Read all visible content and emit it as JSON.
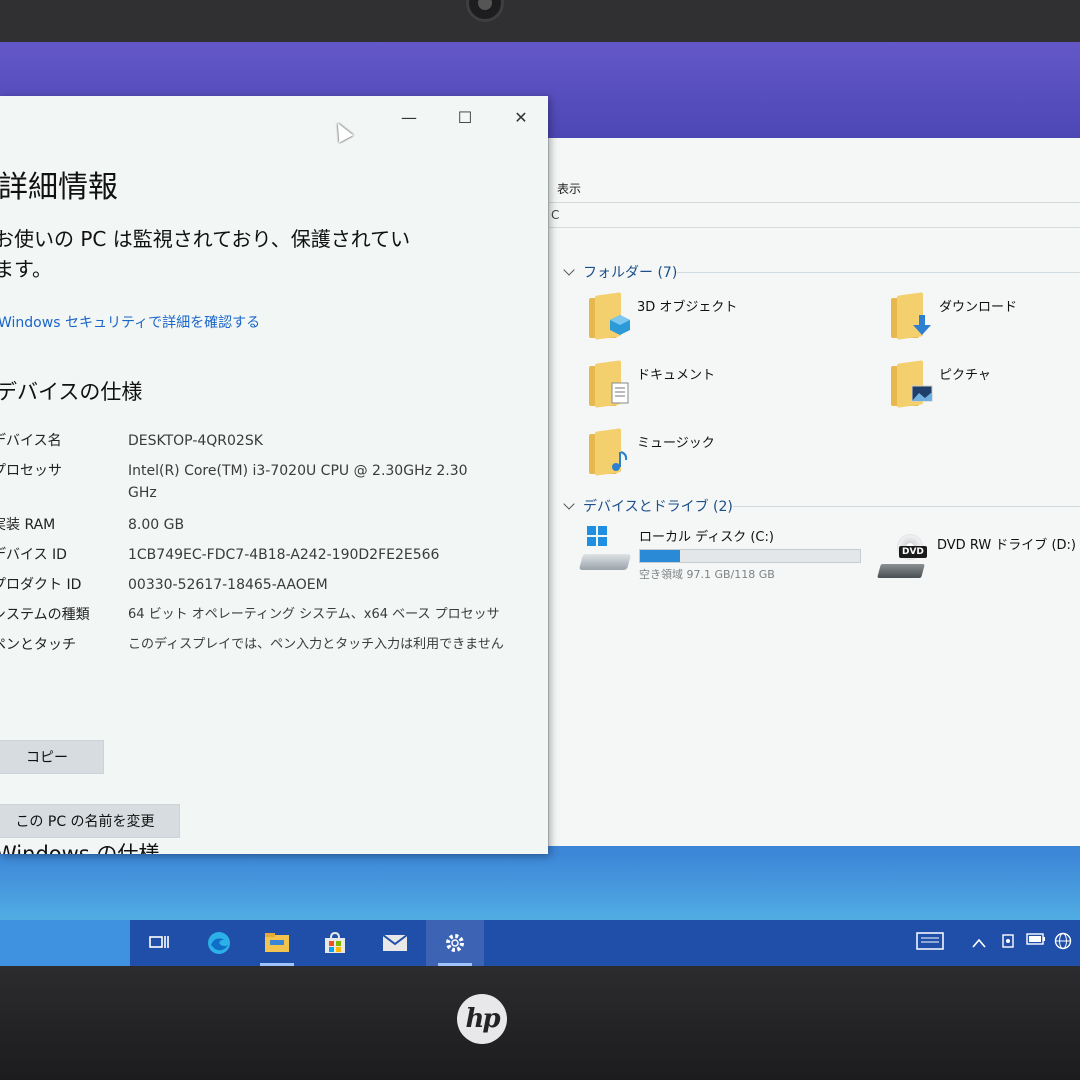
{
  "explorer": {
    "menu_view": "表示",
    "address_fragment": "C",
    "folders_header": "フォルダー (7)",
    "folders": [
      {
        "label": "3D オブジェクト",
        "icon": "3d-objects-icon"
      },
      {
        "label": "ダウンロード",
        "icon": "download-icon"
      },
      {
        "label": "ドキュメント",
        "icon": "document-icon"
      },
      {
        "label": "ピクチャ",
        "icon": "picture-icon"
      },
      {
        "label": "ミュージック",
        "icon": "music-icon"
      }
    ],
    "devices_header": "デバイスとドライブ (2)",
    "local_disk": {
      "name": "ローカル ディスク (C:)",
      "free_text": "空き領域 97.1 GB/118 GB",
      "used_fraction": 0.18
    },
    "dvd_drive": {
      "name": "DVD RW ドライブ (D:)",
      "badge": "DVD"
    }
  },
  "settings": {
    "title": "詳細情報",
    "status": "お使いの PC は監視されており、保護されています。",
    "security_link": "Windows セキュリティで詳細を確認する",
    "device_spec_heading": "デバイスの仕様",
    "specs": [
      {
        "key": "デバイス名",
        "value": "DESKTOP-4QR02SK"
      },
      {
        "key": "プロセッサ",
        "value": "Intel(R) Core(TM) i3-7020U CPU @ 2.30GHz   2.30 GHz"
      },
      {
        "key": "実装 RAM",
        "value": "8.00 GB"
      },
      {
        "key": "デバイス ID",
        "value": "1CB749EC-FDC7-4B18-A242-190D2FE2E566"
      },
      {
        "key": "プロダクト ID",
        "value": "00330-52617-18465-AAOEM"
      },
      {
        "key": "システムの種類",
        "value": "64 ビット オペレーティング システム、x64 ベース プロセッサ"
      },
      {
        "key": "ペンとタッチ",
        "value": "このディスプレイでは、ペン入力とタッチ入力は利用できません"
      }
    ],
    "copy_button": "コピー",
    "rename_button": "この PC の名前を変更",
    "windows_spec_heading": "Windows の仕様"
  },
  "window_controls": {
    "minimize": "—",
    "maximize": "☐",
    "close": "✕"
  },
  "brand": {
    "logo_text": "hp"
  },
  "colors": {
    "accent": "#1a66c8",
    "taskbar": "#1f4fa8",
    "drive_fill": "#2a8ad6"
  }
}
